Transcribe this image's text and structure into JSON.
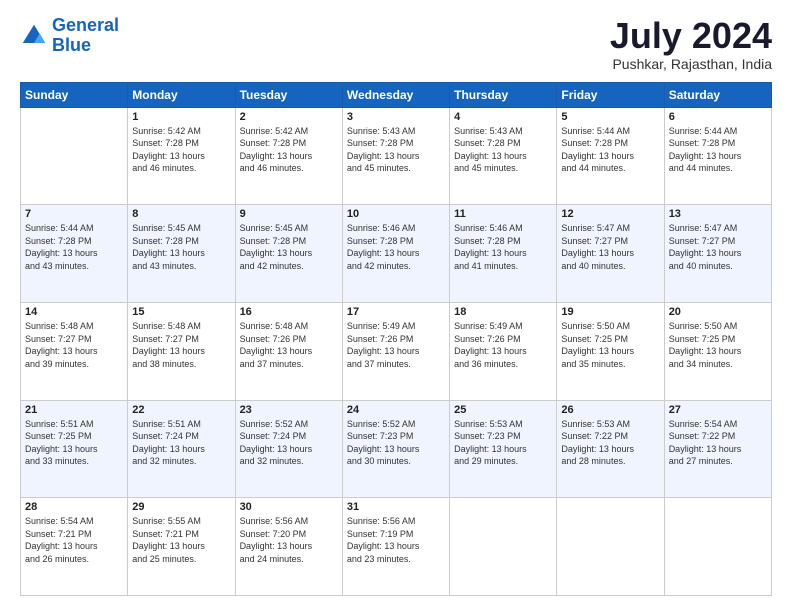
{
  "header": {
    "logo_line1": "General",
    "logo_line2": "Blue",
    "title": "July 2024",
    "subtitle": "Pushkar, Rajasthan, India"
  },
  "calendar": {
    "days_of_week": [
      "Sunday",
      "Monday",
      "Tuesday",
      "Wednesday",
      "Thursday",
      "Friday",
      "Saturday"
    ],
    "weeks": [
      [
        {
          "day": "",
          "info": ""
        },
        {
          "day": "1",
          "info": "Sunrise: 5:42 AM\nSunset: 7:28 PM\nDaylight: 13 hours\nand 46 minutes."
        },
        {
          "day": "2",
          "info": "Sunrise: 5:42 AM\nSunset: 7:28 PM\nDaylight: 13 hours\nand 46 minutes."
        },
        {
          "day": "3",
          "info": "Sunrise: 5:43 AM\nSunset: 7:28 PM\nDaylight: 13 hours\nand 45 minutes."
        },
        {
          "day": "4",
          "info": "Sunrise: 5:43 AM\nSunset: 7:28 PM\nDaylight: 13 hours\nand 45 minutes."
        },
        {
          "day": "5",
          "info": "Sunrise: 5:44 AM\nSunset: 7:28 PM\nDaylight: 13 hours\nand 44 minutes."
        },
        {
          "day": "6",
          "info": "Sunrise: 5:44 AM\nSunset: 7:28 PM\nDaylight: 13 hours\nand 44 minutes."
        }
      ],
      [
        {
          "day": "7",
          "info": "Sunrise: 5:44 AM\nSunset: 7:28 PM\nDaylight: 13 hours\nand 43 minutes."
        },
        {
          "day": "8",
          "info": "Sunrise: 5:45 AM\nSunset: 7:28 PM\nDaylight: 13 hours\nand 43 minutes."
        },
        {
          "day": "9",
          "info": "Sunrise: 5:45 AM\nSunset: 7:28 PM\nDaylight: 13 hours\nand 42 minutes."
        },
        {
          "day": "10",
          "info": "Sunrise: 5:46 AM\nSunset: 7:28 PM\nDaylight: 13 hours\nand 42 minutes."
        },
        {
          "day": "11",
          "info": "Sunrise: 5:46 AM\nSunset: 7:28 PM\nDaylight: 13 hours\nand 41 minutes."
        },
        {
          "day": "12",
          "info": "Sunrise: 5:47 AM\nSunset: 7:27 PM\nDaylight: 13 hours\nand 40 minutes."
        },
        {
          "day": "13",
          "info": "Sunrise: 5:47 AM\nSunset: 7:27 PM\nDaylight: 13 hours\nand 40 minutes."
        }
      ],
      [
        {
          "day": "14",
          "info": "Sunrise: 5:48 AM\nSunset: 7:27 PM\nDaylight: 13 hours\nand 39 minutes."
        },
        {
          "day": "15",
          "info": "Sunrise: 5:48 AM\nSunset: 7:27 PM\nDaylight: 13 hours\nand 38 minutes."
        },
        {
          "day": "16",
          "info": "Sunrise: 5:48 AM\nSunset: 7:26 PM\nDaylight: 13 hours\nand 37 minutes."
        },
        {
          "day": "17",
          "info": "Sunrise: 5:49 AM\nSunset: 7:26 PM\nDaylight: 13 hours\nand 37 minutes."
        },
        {
          "day": "18",
          "info": "Sunrise: 5:49 AM\nSunset: 7:26 PM\nDaylight: 13 hours\nand 36 minutes."
        },
        {
          "day": "19",
          "info": "Sunrise: 5:50 AM\nSunset: 7:25 PM\nDaylight: 13 hours\nand 35 minutes."
        },
        {
          "day": "20",
          "info": "Sunrise: 5:50 AM\nSunset: 7:25 PM\nDaylight: 13 hours\nand 34 minutes."
        }
      ],
      [
        {
          "day": "21",
          "info": "Sunrise: 5:51 AM\nSunset: 7:25 PM\nDaylight: 13 hours\nand 33 minutes."
        },
        {
          "day": "22",
          "info": "Sunrise: 5:51 AM\nSunset: 7:24 PM\nDaylight: 13 hours\nand 32 minutes."
        },
        {
          "day": "23",
          "info": "Sunrise: 5:52 AM\nSunset: 7:24 PM\nDaylight: 13 hours\nand 32 minutes."
        },
        {
          "day": "24",
          "info": "Sunrise: 5:52 AM\nSunset: 7:23 PM\nDaylight: 13 hours\nand 30 minutes."
        },
        {
          "day": "25",
          "info": "Sunrise: 5:53 AM\nSunset: 7:23 PM\nDaylight: 13 hours\nand 29 minutes."
        },
        {
          "day": "26",
          "info": "Sunrise: 5:53 AM\nSunset: 7:22 PM\nDaylight: 13 hours\nand 28 minutes."
        },
        {
          "day": "27",
          "info": "Sunrise: 5:54 AM\nSunset: 7:22 PM\nDaylight: 13 hours\nand 27 minutes."
        }
      ],
      [
        {
          "day": "28",
          "info": "Sunrise: 5:54 AM\nSunset: 7:21 PM\nDaylight: 13 hours\nand 26 minutes."
        },
        {
          "day": "29",
          "info": "Sunrise: 5:55 AM\nSunset: 7:21 PM\nDaylight: 13 hours\nand 25 minutes."
        },
        {
          "day": "30",
          "info": "Sunrise: 5:56 AM\nSunset: 7:20 PM\nDaylight: 13 hours\nand 24 minutes."
        },
        {
          "day": "31",
          "info": "Sunrise: 5:56 AM\nSunset: 7:19 PM\nDaylight: 13 hours\nand 23 minutes."
        },
        {
          "day": "",
          "info": ""
        },
        {
          "day": "",
          "info": ""
        },
        {
          "day": "",
          "info": ""
        }
      ]
    ]
  }
}
